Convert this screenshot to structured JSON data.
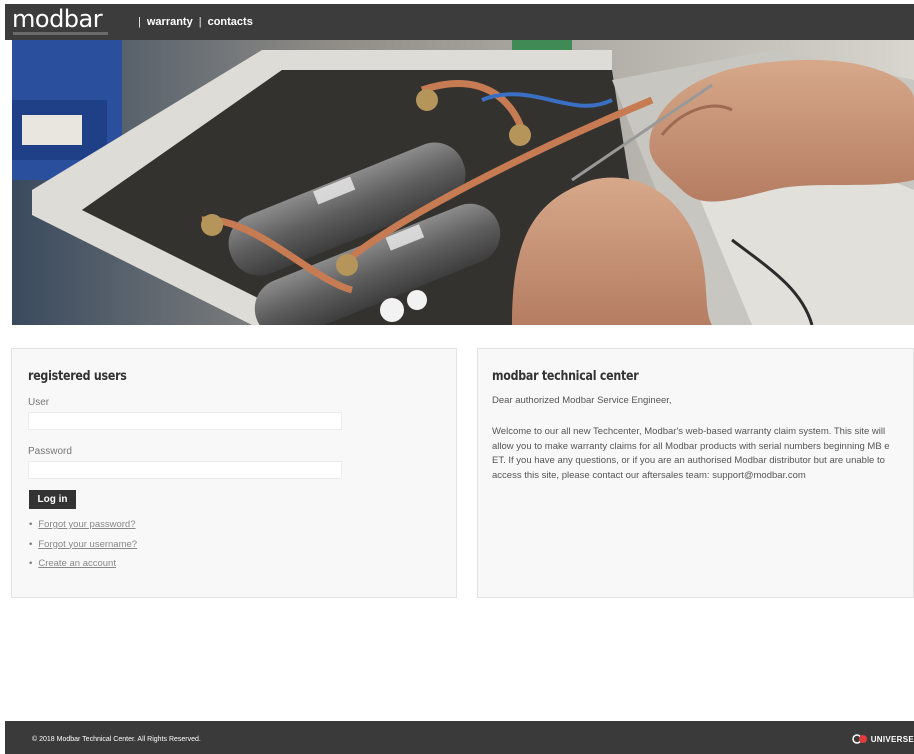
{
  "header": {
    "logo": "modbar",
    "nav": [
      {
        "label": "warranty"
      },
      {
        "label": "contacts"
      }
    ],
    "separator": "|"
  },
  "login": {
    "title": "registered users",
    "user_label": "User",
    "user_value": "",
    "password_label": "Password",
    "password_value": "",
    "button_label": "Log in",
    "links": [
      {
        "label": "Forgot your password?"
      },
      {
        "label": "Forgot your username?"
      },
      {
        "label": "Create an account"
      }
    ]
  },
  "info": {
    "title": "modbar technical center",
    "intro": "Dear authorized Modbar Service Engineer,",
    "body": "Welcome to our all new Techcenter, Modbar's web-based warranty claim system. This site will allow you to make warranty claims for all Modbar products with serial numbers beginning MB e ET. If you have any questions, or if you are an authorised Modbar distributor but are unable to access this site, please contact our aftersales team: support@modbar.com"
  },
  "footer": {
    "copyright": "© 2018 Modbar Technical Center. All Rights Reserved.",
    "partner": "UNIVERSE"
  },
  "colors": {
    "header_bg": "#3c3c3c",
    "footer_bg": "#3a3a3a",
    "button_bg": "#333333",
    "panel_bg": "#f8f8f8"
  }
}
